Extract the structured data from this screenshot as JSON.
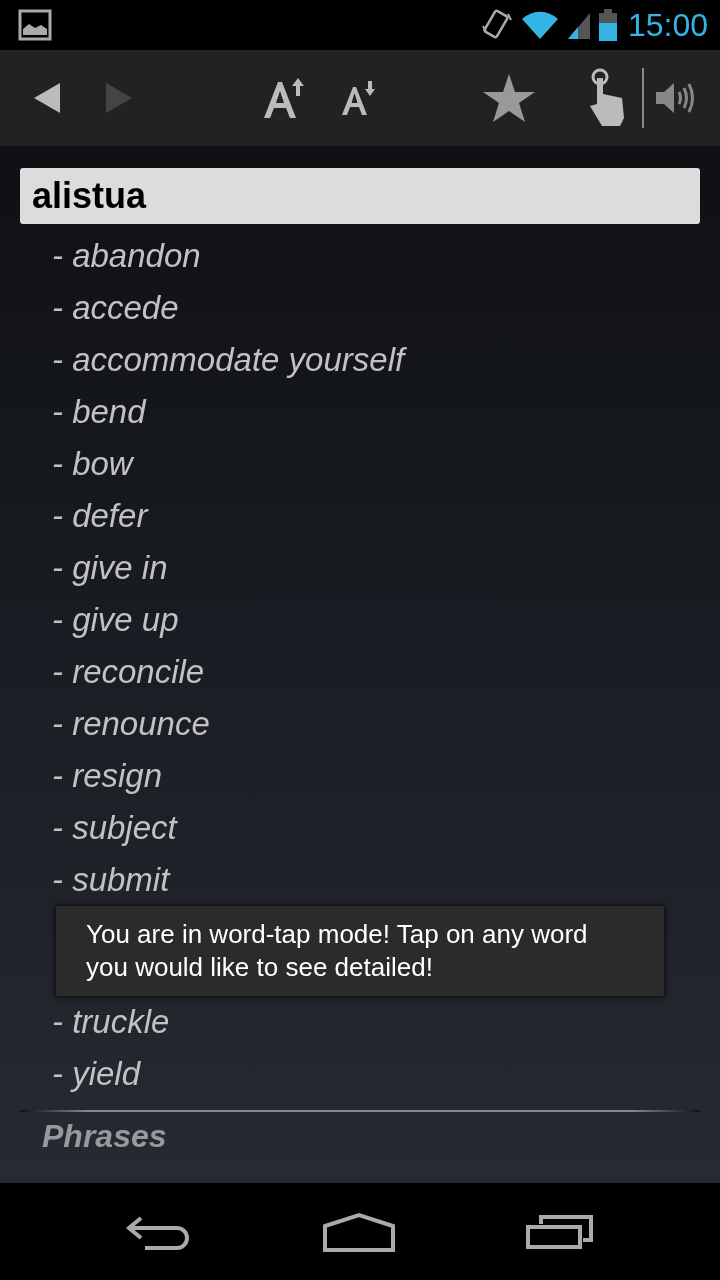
{
  "status_bar": {
    "time": "15:00"
  },
  "toolbar": {
    "buttons": [
      {
        "kind": "back",
        "disabled": false
      },
      {
        "kind": "forward",
        "disabled": true
      },
      {
        "kind": "font-up",
        "disabled": false
      },
      {
        "kind": "font-down",
        "disabled": false
      },
      {
        "kind": "star",
        "disabled": false
      },
      {
        "kind": "word-tap",
        "disabled": false
      },
      {
        "kind": "speaker",
        "disabled": false
      }
    ]
  },
  "headword": "alistua",
  "entries": [
    {
      "kind": "word",
      "text": "- abandon"
    },
    {
      "kind": "word",
      "text": "- accede"
    },
    {
      "kind": "word",
      "text": "- accommodate yourself"
    },
    {
      "kind": "word",
      "text": "- bend"
    },
    {
      "kind": "word",
      "text": "- bow"
    },
    {
      "kind": "word",
      "text": "- defer"
    },
    {
      "kind": "word",
      "text": "- give in"
    },
    {
      "kind": "word",
      "text": "- give up"
    },
    {
      "kind": "word",
      "text": "- reconcile"
    },
    {
      "kind": "word",
      "text": "- renounce"
    },
    {
      "kind": "word",
      "text": "- resign"
    },
    {
      "kind": "word",
      "text": "- subject"
    },
    {
      "kind": "word",
      "text": "- submit"
    },
    {
      "kind": "toast",
      "text": "You are in word-tap mode! Tap on any word you would like to see detailed!"
    },
    {
      "kind": "word",
      "text": "- truckle"
    },
    {
      "kind": "word",
      "text": "- yield"
    }
  ],
  "section_heading": "Phrases"
}
